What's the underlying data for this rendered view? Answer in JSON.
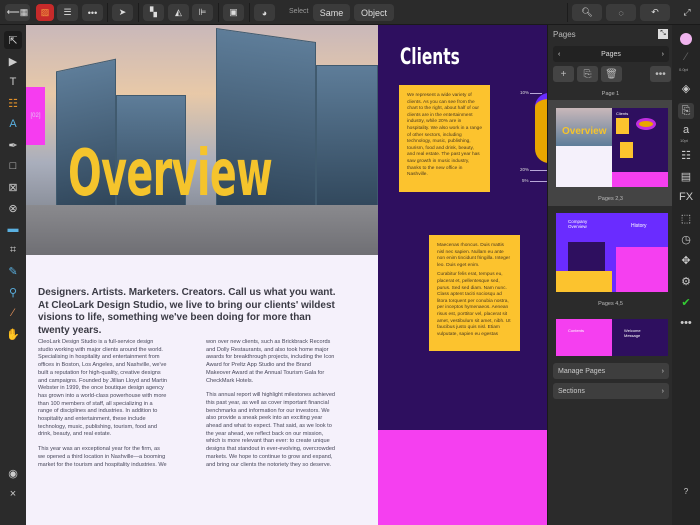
{
  "toolbar": {
    "select_label": "Select",
    "same_label": "Same",
    "object_label": "Object"
  },
  "page_left": {
    "tab_number": "[02]",
    "title": "Overview",
    "lead": "Designers. Artists. Marketers. Creators. Call us what you want. At CleoLark Design Studio, we live to bring our clients' wildest visions to life, something we've been doing for more than twenty years.",
    "col1_p1": "CleoLark Design Studio is a full-service design studio working with major clients around the world. Specialising in hospitality and entertainment from offices in Boston, Los Angeles, and Nashville, we've built a reputation for high-quality, creative designs and campaigns. Founded by Jillian Lloyd and Martin Webster in 1999, the once boutique design agency has grown into a world-class powerhouse with more than 100 members of staff, all specializing in a range of disciplines and industries. In addition to hospitality and entertainment, these include technology, music, publishing, tourism, food and drink, beauty, and real estate.",
    "col1_p2": "This year was an exceptional year for the firm, as we opened a third location in Nashville—a booming market for the tourism and hospitality industries. We",
    "col2_p1": "won over new clients, such as Brickbrack Records and Dolly Restaurants, and also took home major awards for breakthrough projects, including the Icon Award for Preltz App Studio and the Brand Makeover Award at the Annual Tourism Gala for CheckMark Hotels.",
    "col2_p2": "This annual report will highlight milestones achieved this past year, as well as cover important financial benchmarks and information for our investors. We also provide a sneak peek into an exciting year ahead and what to expect. That said, as we look to the year ahead, we reflect back on our mission, which is more relevant than ever: to create unique designs that standout in ever-evolving, overcrowded markets. We hope to continue to grow and expand, and bring our clients the notoriety they so deserve."
  },
  "page_right": {
    "title": "Clients",
    "box1": "We represent a wide variety of clients. As you can see from the chart to the right, about half of our clients are in the entertainment industry, while 20% are in hospitality. We also work in a range of other sectors, including technology, music, publishing, tourism, food and drink, beauty, and real estate. The past year has saw growth in music industry, thanks to the new office in Nashville.",
    "box2_p1": "Maecenas rhoncus. Duis mattis nisl nec sapien. Nullam eu ante non enim tincidunt fringilla. Integer leo. Duis eget enim.",
    "box2_p2": "Curabitur felis erat, tempus eu, placerat et, pellentesque sed, purus. Sed sed diam. Nam nunc. Class aptent taciti sociosqu ad litora torquent per conubia nostra, per inceptos hymenaeos. Aenean risus est, porttitor vel, placerat sit amet, vestibulum sit amet, nibh. Ut faucibus justo quis nisl. Etiam vulputate, sapien eu egestas",
    "pie_labels": [
      "10%",
      "20%",
      "5%"
    ]
  },
  "panel": {
    "title": "Pages",
    "nav_label": "Pages",
    "page1_label": "Page 1",
    "spread1_label": "Pages 2,3",
    "spread2_label": "Pages 4,5",
    "manage_label": "Manage Pages",
    "sections_label": "Sections",
    "thumb_texts": [
      "Overview",
      "Clients",
      "Company Overview",
      "History",
      "Contents",
      "Welcome Message"
    ]
  },
  "strip": {
    "stroke_width": "0.0pt",
    "font_size": "10pt"
  },
  "colors": {
    "purple": "#2e0f5f",
    "magenta": "#f53ff0",
    "yellow": "#fcc32e"
  }
}
